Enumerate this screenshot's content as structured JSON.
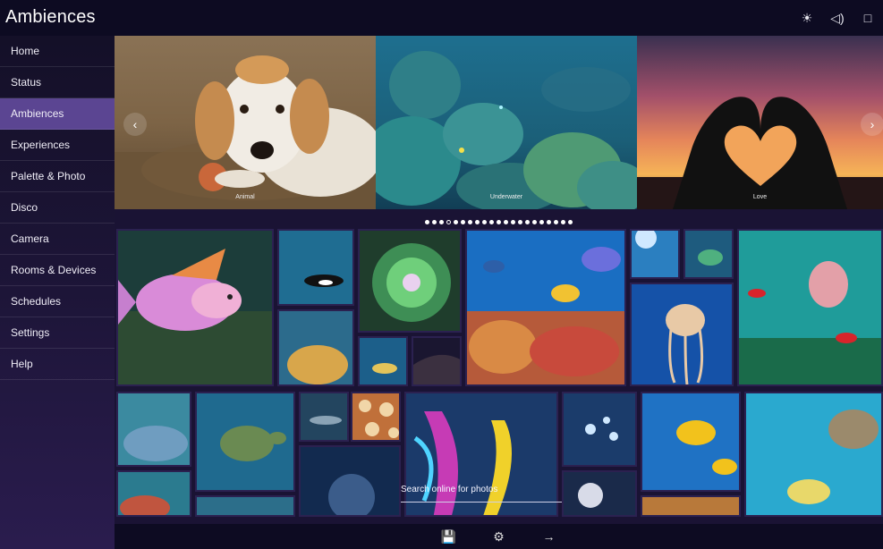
{
  "app": {
    "title": "Ambiences"
  },
  "titlebar_icons": [
    {
      "name": "brightness-icon",
      "glyph": "☀"
    },
    {
      "name": "volume-icon",
      "glyph": "◁)"
    },
    {
      "name": "window-icon",
      "glyph": "□"
    }
  ],
  "sidebar": {
    "items": [
      {
        "label": "Home",
        "active": false
      },
      {
        "label": "Status",
        "active": false
      },
      {
        "label": "Ambiences",
        "active": true
      },
      {
        "label": "Experiences",
        "active": false
      },
      {
        "label": "Palette & Photo",
        "active": false
      },
      {
        "label": "Disco",
        "active": false
      },
      {
        "label": "Camera",
        "active": false
      },
      {
        "label": "Rooms & Devices",
        "active": false
      },
      {
        "label": "Schedules",
        "active": false
      },
      {
        "label": "Settings",
        "active": false
      },
      {
        "label": "Help",
        "active": false
      }
    ]
  },
  "carousel": {
    "slides": [
      {
        "caption": "Animal"
      },
      {
        "caption": "Underwater"
      },
      {
        "caption": "Love"
      }
    ],
    "prev_glyph": "‹",
    "next_glyph": "›",
    "dot_count": 21,
    "active_dot": 3
  },
  "search": {
    "label": "Search online for photos"
  },
  "bottombar_icons": [
    {
      "name": "save-icon",
      "glyph": "💾"
    },
    {
      "name": "settings-icon",
      "glyph": "⚙"
    },
    {
      "name": "forward-arrow-icon",
      "glyph": "→"
    }
  ],
  "colors": {
    "accent": "#5b4592",
    "sidebar_bg": "#1d1538",
    "main_bg": "#1a1334"
  }
}
